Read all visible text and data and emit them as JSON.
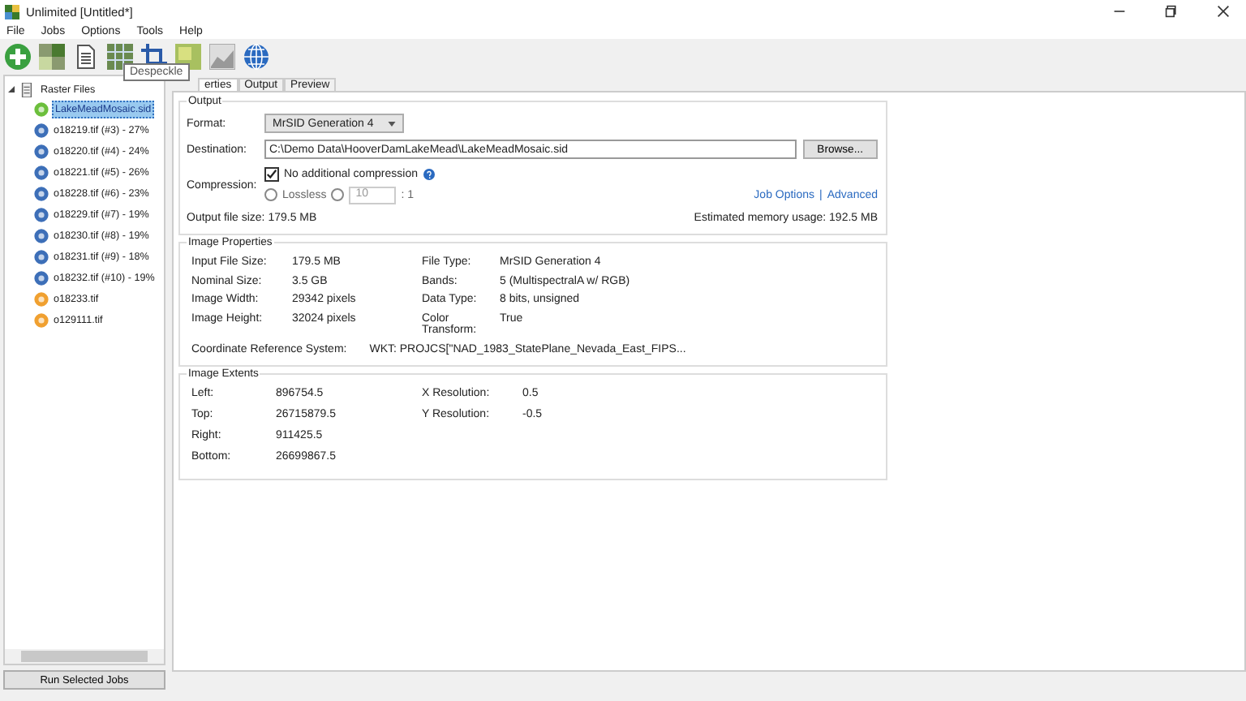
{
  "window": {
    "title": "Unlimited [Untitled*]"
  },
  "menu": [
    "File",
    "Jobs",
    "Options",
    "Tools",
    "Help"
  ],
  "toolbar": {
    "tooltip": "Despeckle"
  },
  "tree": {
    "root": {
      "label": "Raster Files",
      "expanded": true,
      "children": [
        {
          "label": "LakeMeadMosaic.sid",
          "kind": "mosaic",
          "selected": true
        },
        {
          "label": "o18219.tif (#3) - 27%",
          "kind": "job",
          "selected": false
        },
        {
          "label": "o18220.tif (#4) - 24%",
          "kind": "job",
          "selected": false
        },
        {
          "label": "o18221.tif (#5) - 26%",
          "kind": "job",
          "selected": false
        },
        {
          "label": "o18228.tif (#6) - 23%",
          "kind": "job",
          "selected": false
        },
        {
          "label": "o18229.tif (#7) - 19%",
          "kind": "job",
          "selected": false
        },
        {
          "label": "o18230.tif (#8) - 19%",
          "kind": "job",
          "selected": false
        },
        {
          "label": "o18231.tif (#9) - 18%",
          "kind": "job",
          "selected": false
        },
        {
          "label": "o18232.tif (#10) - 19%",
          "kind": "job",
          "selected": false
        },
        {
          "label": "o18233.tif",
          "kind": "file",
          "selected": false
        },
        {
          "label": "o129111.tif",
          "kind": "file",
          "selected": false
        }
      ]
    }
  },
  "run_button": "Run Selected Jobs",
  "tabs": [
    {
      "label": "erties",
      "selected": true
    },
    {
      "label": "Output",
      "selected": false
    },
    {
      "label": "Preview",
      "selected": false
    }
  ],
  "output": {
    "title": "Output",
    "format_label": "Format:",
    "format": "MrSID Generation 4",
    "destination_label": "Destination:",
    "destination": "C:\\Demo Data\\HooverDamLakeMead\\LakeMeadMosaic.sid",
    "browse": "Browse...",
    "compression_label": "Compression:",
    "no_compression": {
      "label": "No additional compression",
      "checked": true
    },
    "lossless": {
      "label": "Lossless",
      "selected": false
    },
    "ratio": {
      "selected": false,
      "value": "10",
      "suffix": ": 1"
    },
    "job_options": "Job Options",
    "separator": "|",
    "advanced": "Advanced",
    "file_size": "Output file size: 179.5 MB",
    "memory": "Estimated memory usage: 192.5 MB"
  },
  "properties": {
    "title": "Image Properties",
    "rows": [
      [
        "Input File Size:",
        "179.5 MB",
        "File Type:",
        "MrSID Generation 4"
      ],
      [
        "Nominal Size:",
        "3.5 GB",
        "Bands:",
        "5 (MultispectralA w/ RGB)"
      ],
      [
        "Image Width:",
        "29342 pixels",
        "Data Type:",
        "8 bits, unsigned"
      ],
      [
        "Image Height:",
        "32024 pixels",
        "Color Transform:",
        "True"
      ]
    ],
    "crs_label": "Coordinate Reference System:",
    "crs": "WKT: PROJCS[\"NAD_1983_StatePlane_Nevada_East_FIPS..."
  },
  "extents": {
    "title": "Image Extents",
    "rows": [
      [
        "Left:",
        "896754.5",
        "X Resolution:",
        "0.5"
      ],
      [
        "Top:",
        "26715879.5",
        "Y Resolution:",
        "-0.5"
      ],
      [
        "Right:",
        "911425.5"
      ],
      [
        "Bottom:",
        "26699867.5"
      ]
    ]
  }
}
